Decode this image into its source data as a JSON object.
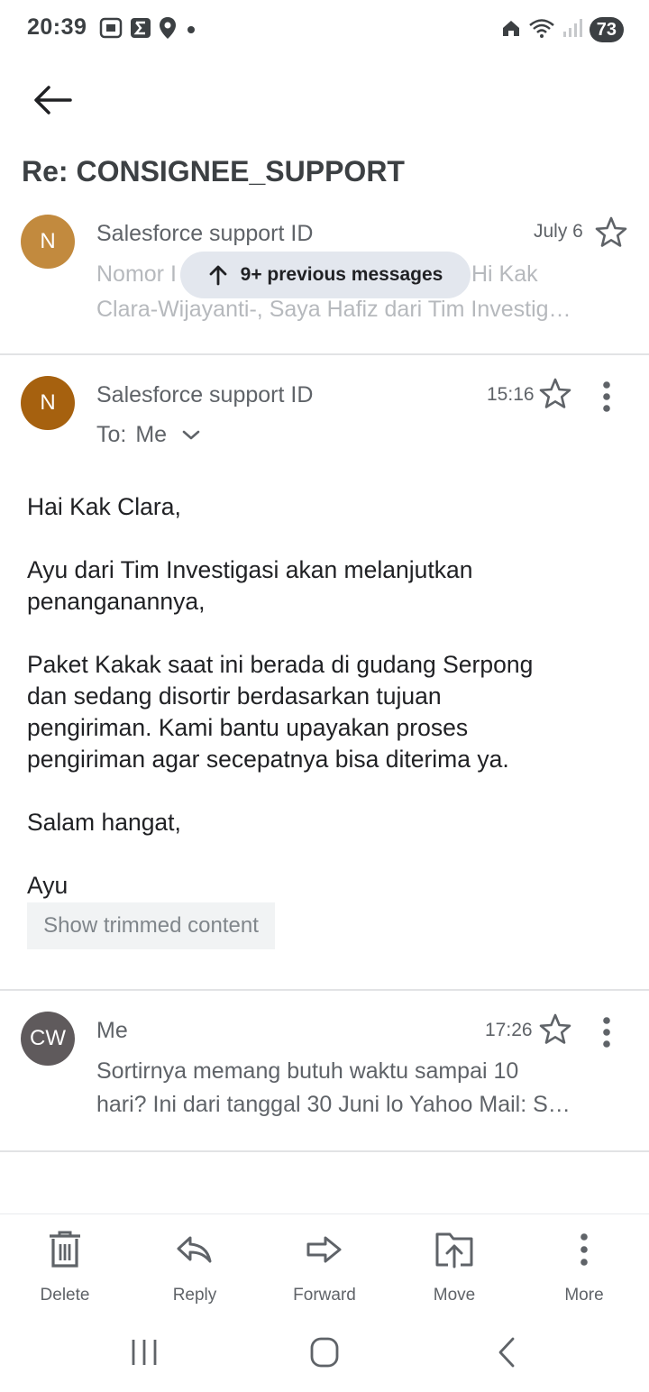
{
  "status_bar": {
    "time": "20:39",
    "battery": "73",
    "icons_left": [
      "screenshot-icon",
      "sigma-icon",
      "location-icon",
      "dot-icon"
    ],
    "icons_right": [
      "home-icon",
      "wifi-icon",
      "signal-icon",
      "battery-icon"
    ]
  },
  "header": {
    "subject": "Re: CONSIGNEE_SUPPORT"
  },
  "collapsed_message": {
    "avatar": "N",
    "avatar_color": "#c28a3e",
    "sender": "Salesforce support ID",
    "date": "July 6",
    "preview_line1_left": "Nomor I",
    "preview_line1_right": "Hi Kak",
    "preview_line2": "Clara-Wijayanti-, Saya Hafiz dari Tim Investig…",
    "previous_messages": "9+ previous messages"
  },
  "expanded_message": {
    "avatar": "N",
    "avatar_color": "#a6610f",
    "sender": "Salesforce support ID",
    "time": "15:16",
    "to_label": "To:",
    "to_value": "Me",
    "body": {
      "greeting": "Hai Kak Clara,",
      "p1_line1": "Ayu dari Tim Investigasi akan melanjutkan",
      "p1_line2": "penanganannya,",
      "p2_line1": "Paket Kakak saat ini berada di gudang Serpong",
      "p2_line2": "dan sedang disortir berdasarkan tujuan",
      "p2_line3": "pengiriman. Kami bantu upayakan proses",
      "p2_line4": "pengiriman agar secepatnya bisa diterima ya.",
      "closing": "Salam hangat,",
      "signature": "Ayu"
    },
    "show_trimmed": "Show trimmed content"
  },
  "reply_message": {
    "avatar": "CW",
    "avatar_color": "#5f5a5c",
    "sender": "Me",
    "time": "17:26",
    "snippet_line1": "Sortirnya memang butuh waktu sampai 10",
    "snippet_line2": "hari? Ini dari tanggal 30 Juni lo Yahoo Mail: S…"
  },
  "toolbar": {
    "delete": "Delete",
    "reply": "Reply",
    "forward": "Forward",
    "move": "Move",
    "more": "More"
  },
  "colors": {
    "text_primary": "#202124",
    "text_secondary": "#5f6368",
    "pill_bg": "#e3e7ee"
  }
}
